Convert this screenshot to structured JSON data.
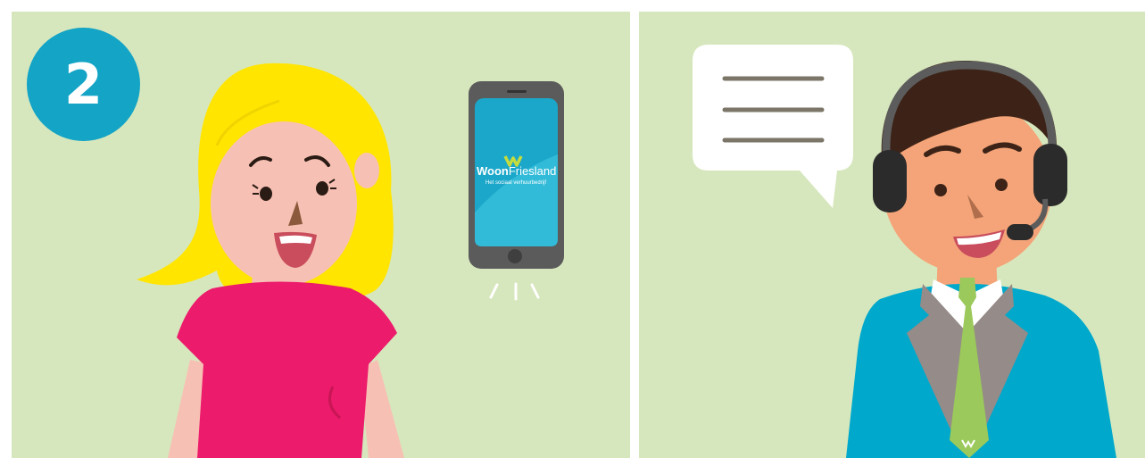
{
  "step": {
    "number": "2"
  },
  "phone": {
    "brand_main": "Woon",
    "brand_accent": "Friesland",
    "tagline": "Het sociaal verhuurbedrijf"
  },
  "colors": {
    "background": "#d7e7bd",
    "badge": "#13a4c6",
    "woman_hair": "#ffe500",
    "woman_shirt": "#ec1b6b",
    "skin_woman": "#f7c0b4",
    "skin_man": "#f4a478",
    "man_hair": "#3d2317",
    "suit": "#00a9cc",
    "lapel": "#958b88",
    "tie": "#9bc95b",
    "phone_body": "#5b5b5b",
    "phone_screen": "#1ba7c9",
    "speech_bubble": "#ffffff",
    "speech_lines": "#7b7668"
  },
  "icons": [
    "step-number-badge",
    "smartphone-icon",
    "ringing-lines-icon",
    "speech-bubble-icon",
    "headset-icon"
  ]
}
